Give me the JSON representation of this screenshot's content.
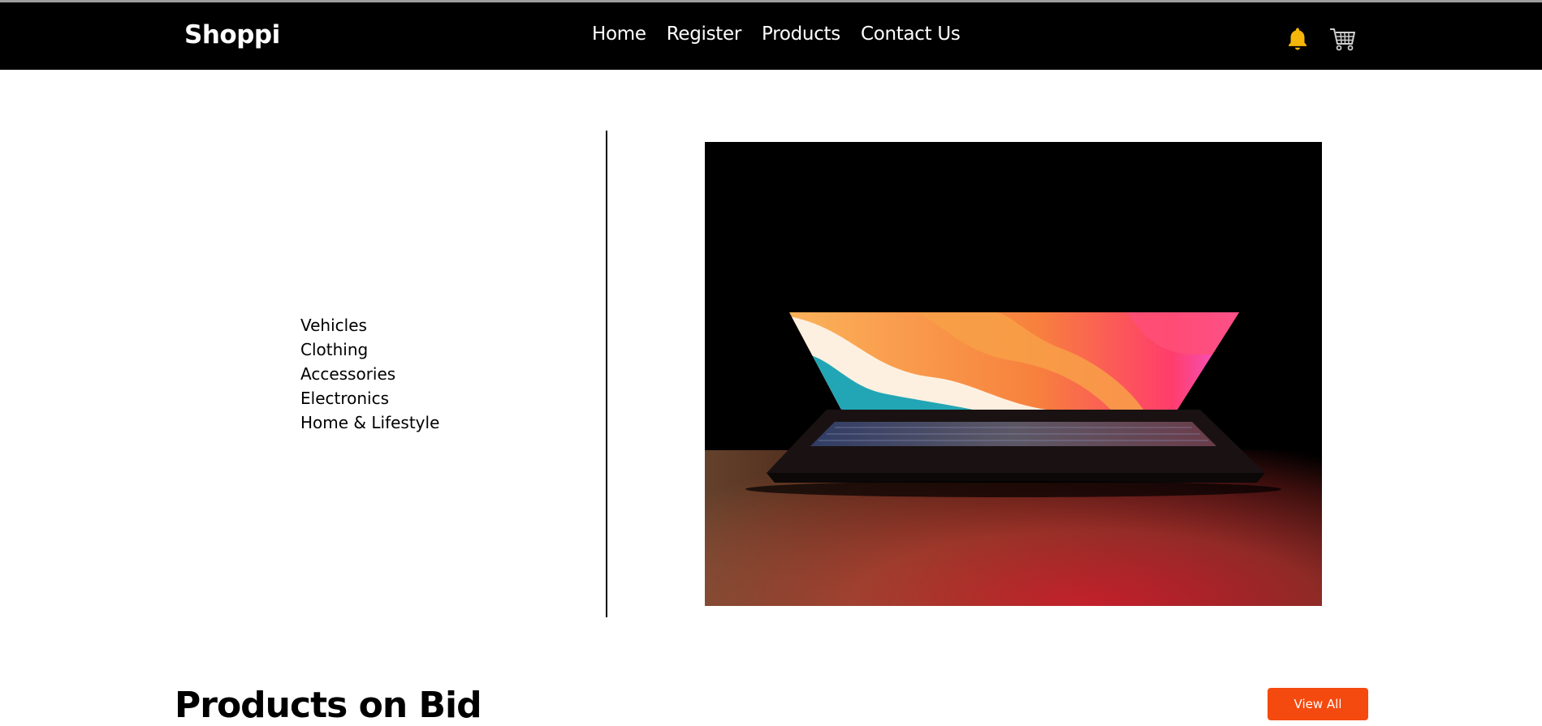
{
  "brand": "Shoppi",
  "nav": {
    "links": [
      "Home",
      "Register",
      "Products",
      "Contact Us"
    ]
  },
  "icons": {
    "bell": "bell-icon",
    "cart": "cart-icon",
    "bell_color": "#f5b50a"
  },
  "categories": [
    "Vehicles",
    "Clothing",
    "Accessories",
    "Electronics",
    "Home & Lifestyle"
  ],
  "section": {
    "title": "Products on Bid",
    "view_all_label": "View All"
  },
  "colors": {
    "navbar": "#000000",
    "accent": "#f54a0f"
  }
}
